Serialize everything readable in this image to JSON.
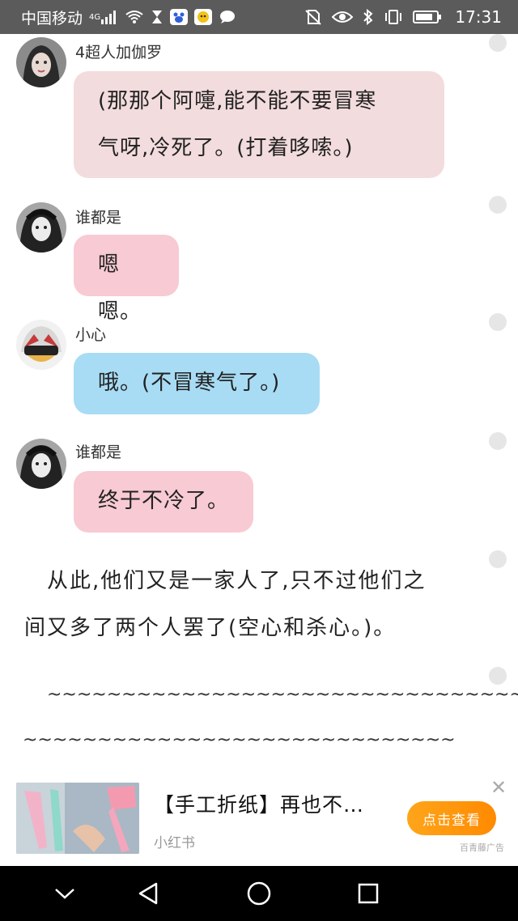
{
  "status_bar": {
    "carrier": "中国移动",
    "network": "4G",
    "time": "17:31",
    "icons": [
      "signal-icon",
      "wifi-icon",
      "hourglass-icon",
      "baidu-app-icon",
      "app-icon",
      "chat-bubble-icon",
      "no-sim-icon",
      "eye-icon",
      "bluetooth-icon",
      "vibrate-icon",
      "battery-icon"
    ]
  },
  "messages": [
    {
      "sender": "4超人加伽罗",
      "text_lines": [
        "(那那个阿嚏,能不能不要冒寒",
        "气呀,冷死了。(打着哆嗦。)"
      ],
      "bubble_color": "#f3dcdd"
    },
    {
      "sender": "谁都是",
      "text_lines": [
        "嗯嗯。"
      ],
      "bubble_color": "#f8cad3"
    },
    {
      "sender": "小心",
      "text_lines": [
        "哦。(不冒寒气了。)"
      ],
      "bubble_color": "#a8dcf4"
    },
    {
      "sender": "谁都是",
      "text_lines": [
        "终于不冷了。"
      ],
      "bubble_color": "#f8cad3"
    }
  ],
  "narration": {
    "lines": [
      "从此,他们又是一家人了,只不过他们之",
      "间又多了两个人罢了(空心和杀心。)。"
    ]
  },
  "separator": {
    "line1": "~~~~~~~~~~~~~~~~~~~~~~~~~~~~~~~~",
    "line2": "~~~~~~~~~~~~~~~~~~~~~~~~~~~~~"
  },
  "ad": {
    "title": "【手工折纸】再也不…",
    "source": "小红书",
    "button": "点击查看",
    "close": "✕",
    "mark": "百青藤广告"
  },
  "nav_bar": {
    "buttons": [
      "back-icon",
      "home-icon",
      "recents-icon",
      "collapse-icon"
    ]
  }
}
